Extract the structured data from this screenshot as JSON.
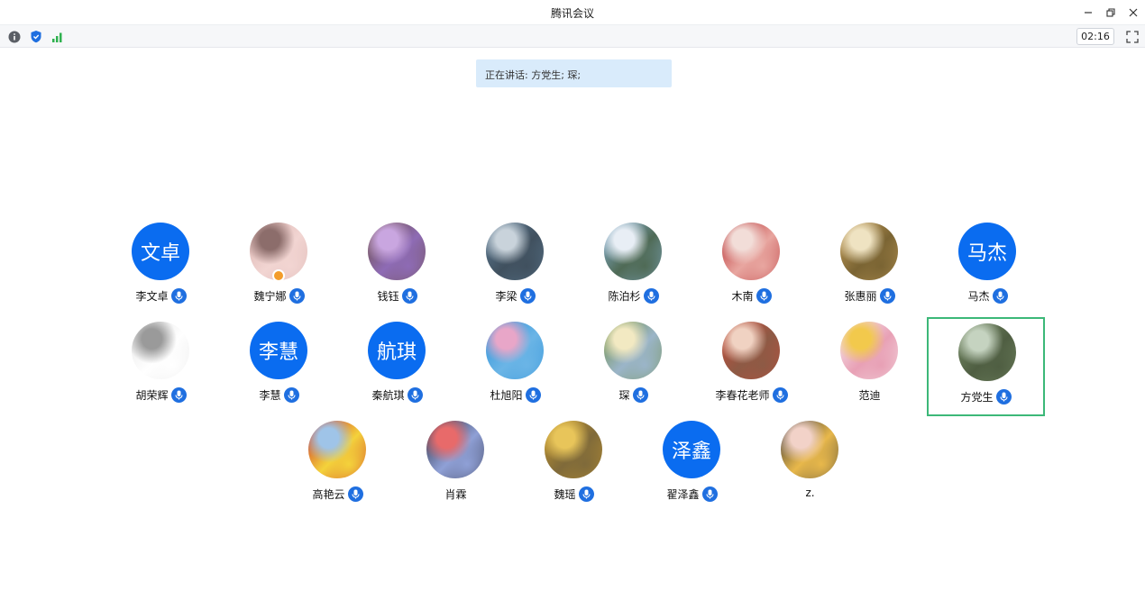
{
  "window": {
    "title": "腾讯会议"
  },
  "toolbar": {
    "timer": "02:16"
  },
  "banner": {
    "speaking_text": "正在讲话: 方党生; 琛;"
  },
  "participants": [
    {
      "name": "李文卓",
      "avatar_text": "文卓",
      "avatar_type": "text",
      "mic": "on"
    },
    {
      "name": "魏宁娜",
      "avatar_type": "photo",
      "palette": [
        "#d9b3b0",
        "#8c6d6b",
        "#f2d5d2"
      ],
      "mic": "on",
      "host": true
    },
    {
      "name": "钱钰",
      "avatar_type": "photo",
      "palette": [
        "#6b4f3a",
        "#c9a6e0",
        "#8e6bb5"
      ],
      "mic": "on"
    },
    {
      "name": "李梁",
      "avatar_type": "photo",
      "palette": [
        "#5f7f99",
        "#c9d3db",
        "#40505e"
      ],
      "mic": "on"
    },
    {
      "name": "陈泊杉",
      "avatar_type": "photo",
      "palette": [
        "#8db9e0",
        "#e8eef5",
        "#4f6a55"
      ],
      "mic": "on"
    },
    {
      "name": "木南",
      "avatar_type": "photo",
      "palette": [
        "#b3262a",
        "#f2ddd8",
        "#e8a6a0"
      ],
      "mic": "on"
    },
    {
      "name": "张惠丽",
      "avatar_type": "photo",
      "palette": [
        "#c9a25e",
        "#efe3c2",
        "#7a6433"
      ],
      "mic": "on"
    },
    {
      "name": "马杰",
      "avatar_text": "马杰",
      "avatar_type": "text",
      "mic": "on"
    },
    {
      "name": "胡荣辉",
      "avatar_type": "photo",
      "palette": [
        "#e6e6e6",
        "#9a9a9a",
        "#ffffff"
      ],
      "mic": "on"
    },
    {
      "name": "李慧",
      "avatar_text": "李慧",
      "avatar_type": "text",
      "mic": "on"
    },
    {
      "name": "秦航琪",
      "avatar_text": "航琪",
      "avatar_type": "text",
      "mic": "on"
    },
    {
      "name": "杜旭阳",
      "avatar_type": "photo",
      "palette": [
        "#2a8fd8",
        "#e8a6c8",
        "#6bb5e6"
      ],
      "mic": "on"
    },
    {
      "name": "琛",
      "avatar_type": "photo",
      "palette": [
        "#6f8e3a",
        "#f2e9c2",
        "#9bb5c9"
      ],
      "mic": "speaking"
    },
    {
      "name": "李春花老师",
      "avatar_type": "photo",
      "palette": [
        "#c94b3b",
        "#f0d2c2",
        "#8d5a45"
      ],
      "mic": "on"
    },
    {
      "name": "范迪",
      "avatar_type": "photo",
      "palette": [
        "#f7f1f3",
        "#f2c94c",
        "#e8a0b5"
      ],
      "mic": "none"
    },
    {
      "name": "方党生",
      "avatar_type": "photo",
      "palette": [
        "#7a8f6a",
        "#c5d3c0",
        "#4f5e42"
      ],
      "mic": "speaking",
      "active": true
    },
    {
      "name": "高艳云",
      "avatar_type": "photo",
      "palette": [
        "#c8202a",
        "#9fc4e8",
        "#f4d23b"
      ],
      "mic": "on"
    },
    {
      "name": "肖霖",
      "avatar_type": "photo",
      "palette": [
        "#2b2b3a",
        "#e86a6a",
        "#8fa0d6"
      ],
      "mic": "none"
    },
    {
      "name": "魏瑶",
      "avatar_type": "photo",
      "palette": [
        "#c99a2e",
        "#e8c55a",
        "#7f6a3a"
      ],
      "mic": "on"
    },
    {
      "name": "翟泽鑫",
      "avatar_text": "泽鑫",
      "avatar_type": "text",
      "mic": "on"
    },
    {
      "name": "z.",
      "avatar_type": "photo",
      "palette": [
        "#2d2f3a",
        "#f2d2c8",
        "#e8b84b"
      ],
      "mic": "none"
    }
  ],
  "colors": {
    "accent": "#0a6cf0",
    "active_border": "#3cb878",
    "banner_bg": "#d9ebfb"
  },
  "icons": [
    "info-icon",
    "shield-icon",
    "signal-icon",
    "fullscreen-icon",
    "minimize-icon",
    "restore-icon",
    "close-icon",
    "mic-icon"
  ]
}
